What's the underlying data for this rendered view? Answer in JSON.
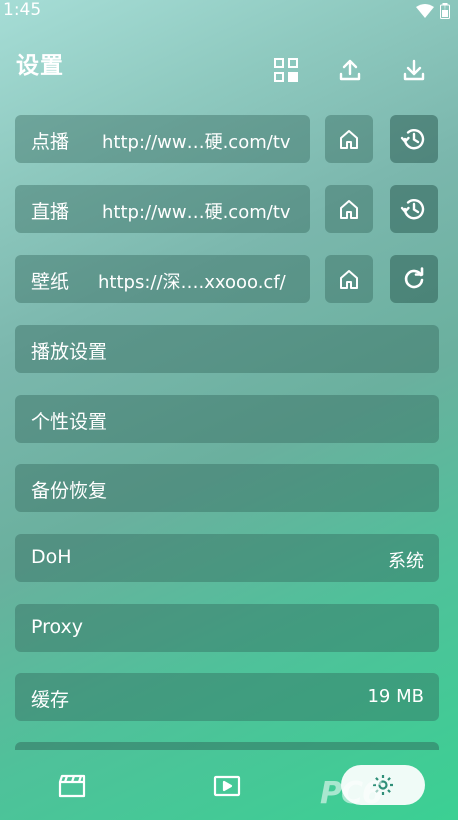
{
  "status": {
    "time": "1:45"
  },
  "header": {
    "title": "设置"
  },
  "rows": {
    "vod": {
      "label": "点播",
      "value": "http://ww…硬.com/tv"
    },
    "live": {
      "label": "直播",
      "value": "http://ww…硬.com/tv"
    },
    "wallpaper": {
      "label": "壁纸",
      "value": "https://深….xxooo.cf/"
    },
    "playback": {
      "label": "播放设置"
    },
    "personal": {
      "label": "个性设置"
    },
    "backup": {
      "label": "备份恢复"
    },
    "doh": {
      "label": "DoH",
      "value": "系统"
    },
    "proxy": {
      "label": "Proxy"
    },
    "cache": {
      "label": "缓存",
      "value": "19 MB"
    }
  },
  "watermark": {
    "text": "PC6"
  },
  "icons": [
    "qrcode-icon",
    "upload-icon",
    "download-icon",
    "home-icon",
    "history-icon",
    "refresh-icon",
    "film-icon",
    "play-icon",
    "gear-icon"
  ]
}
